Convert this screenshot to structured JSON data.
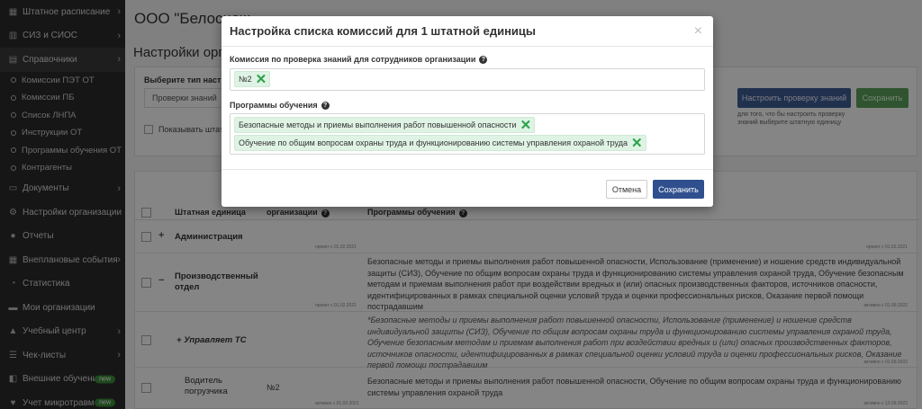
{
  "sidebar": {
    "items": [
      {
        "label": "Штатное расписание",
        "icon": "calendar-icon",
        "chevron": "›"
      },
      {
        "label": "СИЗ и СИОС",
        "icon": "grid-icon",
        "chevron": "›"
      },
      {
        "label": "Справочники",
        "icon": "book-icon",
        "chevron": "›"
      }
    ],
    "subitems": [
      {
        "label": "Комиссии ПЭТ ОТ"
      },
      {
        "label": "Комиссии ПБ"
      },
      {
        "label": "Список ЛНПА"
      },
      {
        "label": "Инструкции ОТ"
      },
      {
        "label": "Программы обучения ОТ"
      },
      {
        "label": "Контрагенты"
      }
    ],
    "items2": [
      {
        "label": "Документы",
        "icon": "document-icon",
        "chevron": "›"
      },
      {
        "label": "Настройки организации",
        "icon": "gear-icon",
        "chevron": ""
      },
      {
        "label": "Отчеты",
        "icon": "info-icon",
        "chevron": ""
      },
      {
        "label": "Внеплановые события",
        "icon": "calendar-icon",
        "chevron": "›"
      },
      {
        "label": "Статистика",
        "icon": "chart-icon",
        "chevron": ""
      },
      {
        "label": "Мои организации",
        "icon": "folder-icon",
        "chevron": ""
      },
      {
        "label": "Учебный центр",
        "icon": "graduation-icon",
        "chevron": "›"
      },
      {
        "label": "Чек-листы",
        "icon": "checklist-icon",
        "chevron": "›"
      },
      {
        "label": "Внешние обучения",
        "icon": "external-icon",
        "badge": "new"
      },
      {
        "label": "Учет микротравм",
        "icon": "heart-icon",
        "badge": "new"
      }
    ]
  },
  "main": {
    "page_title": "ООО \"Белоснеж",
    "section_title": "Настройки орга",
    "panel_label": "Выберите тип настр",
    "select_value": "Проверки знаний",
    "checkbox_label": "Показывать штатн",
    "setup_button": "Настроить проверку знаний",
    "save_button": "Сохранить",
    "setup_hint": "для того, что бы настроить проверку знаний выберите штатную единицу"
  },
  "table": {
    "headers": {
      "unit": "Штатная единица",
      "org": "организации",
      "programs": "Программы обучения"
    },
    "rows": [
      {
        "name": "Администрация",
        "text": "",
        "stamp_left": "проект с 01.02.2021",
        "stamp_right": "проект с 01.02.2021"
      },
      {
        "name": "Производственный отдел",
        "text": "Безопасные методы и приемы выполнения работ повышенной опасности, Использование (применение) и ношение средств индивидуальной защиты (СИЗ), Обучение по общим вопросам охраны труда и функционированию системы управления охраной труда, Обучение безопасным методам и приемам выполнения работ при воздействии вредных и (или) опасных производственных факторов, источников опасности, идентифицированных в рамках специальной оценки условий труда и оценки профессиональных рисков, Оказание первой помощи пострадавшим",
        "stamp_left": "проект с 01.02.2021",
        "stamp_right": "активно с 01.09.2022"
      },
      {
        "name": "Управляет ТС",
        "text": "*Безопасные методы и приемы выполнения работ повышенной опасности, Использование (применение) и ношение средств индивидуальной защиты (СИЗ), Обучение по общим вопросам охраны труда и функционированию системы управления охраной труда, Обучение безопасным методам и приемам выполнения работ при воздействии вредных и (или) опасных производственных факторов, источников опасности, идентифицированных в рамках специальной оценки условий труда и оценки профессиональных рисков, Оказание первой помощи пострадавшим",
        "stamp_left": "проект с 01.02.2021",
        "stamp_right": "активно с 01.09.2022"
      },
      {
        "name": "Водитель погрузчика",
        "org": "№2",
        "text": "Безопасные методы и приемы выполнения работ повышенной опасности, Обучение по общим вопросам охраны труда и функционированию системы управления охраной труда",
        "stamp_left": "активно с 01.02.2021",
        "stamp_right": "активно с 13.09.2022"
      }
    ]
  },
  "modal": {
    "title": "Настройка списка комиссий для 1 штатной единицы",
    "close": "×",
    "commission_label": "Комиссия по проверка знаний для сотрудников организации",
    "commission_tags": [
      "№2"
    ],
    "programs_label": "Программы обучения",
    "program_tags": [
      "Безопасные методы и приемы выполнения работ повышенной опасности",
      "Обучение по общим вопросам охраны труда и функционированию системы управления охраной труда"
    ],
    "remove_glyph": "✕",
    "cancel_button": "Отмена",
    "save_button": "Сохранить"
  },
  "colors": {
    "sidebar_bg": "#2b2b2b",
    "primary": "#2f4f8f",
    "tag_bg": "#dff3e4",
    "tag_remove": "#2aa24a",
    "badge_new": "#3c8d3c"
  }
}
